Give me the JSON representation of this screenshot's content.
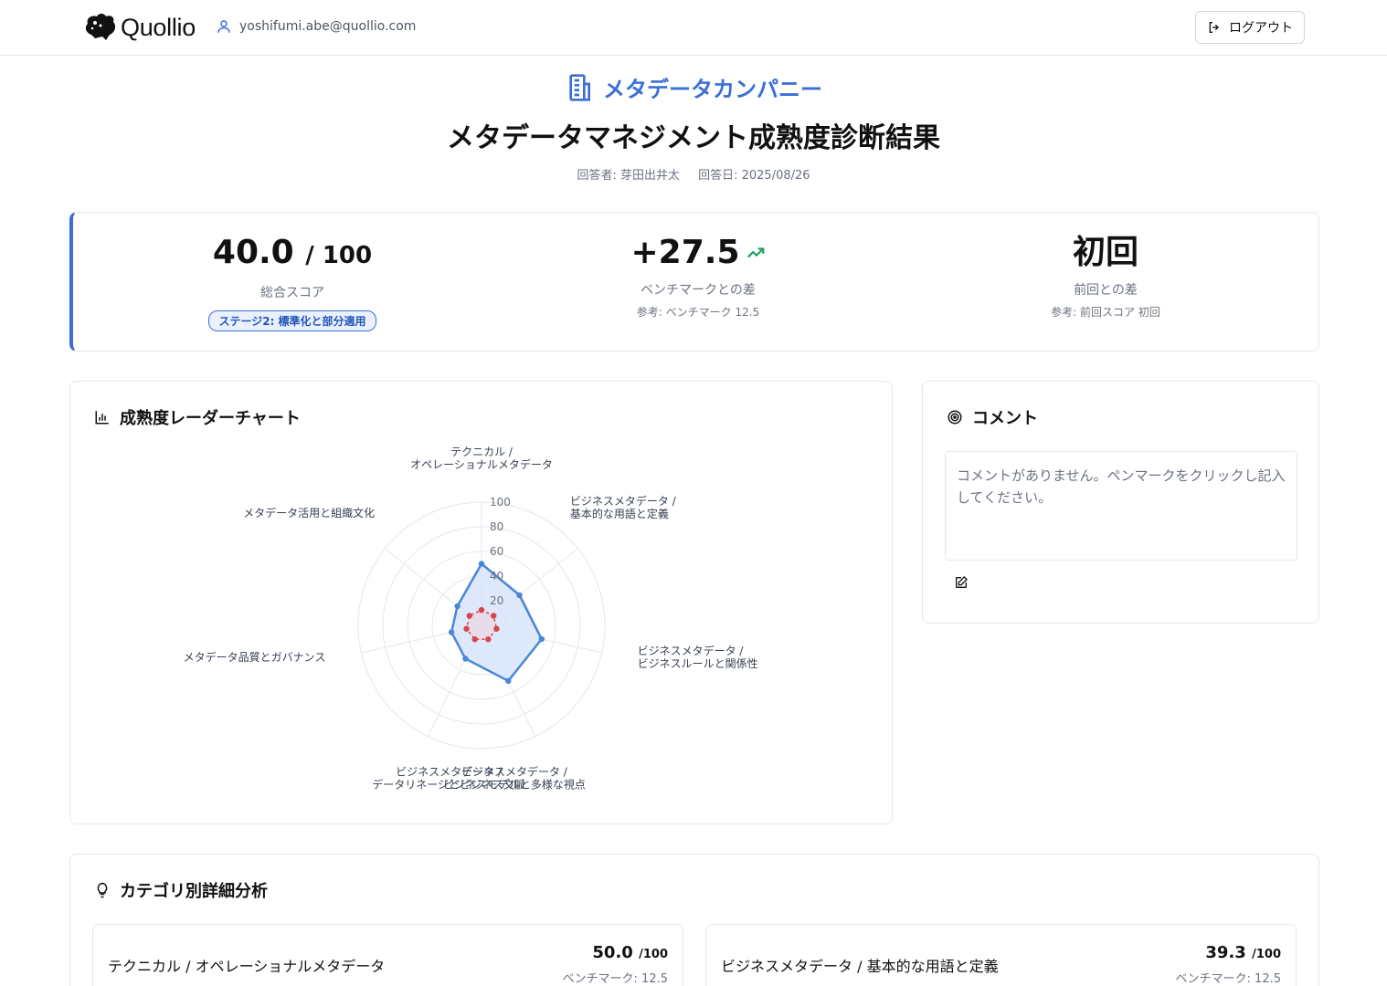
{
  "header": {
    "logo_text": "Quollio",
    "user_email": "yoshifumi.abe@quollio.com",
    "logout_label": "ログアウト"
  },
  "company_name": "メタデータカンパニー",
  "title": "メタデータマネジメント成熟度診断結果",
  "respondent": "回答者: 芽田出井太",
  "answered_date": "回答日: 2025/08/26",
  "score": {
    "total": "40.0",
    "max": "/ 100",
    "total_label": "総合スコア",
    "stage": "ステージ2: 標準化と部分適用",
    "bench_diff": "+27.5",
    "bench_label": "ベンチマークとの差",
    "bench_ref": "参考: ベンチマーク 12.5",
    "prev_diff": "初回",
    "prev_label": "前回との差",
    "prev_ref": "参考: 前回スコア 初回"
  },
  "radar": {
    "title": "成熟度レーダーチャート"
  },
  "chart_data": {
    "type": "radar",
    "axes": [
      [
        "テクニカル /",
        "オペレーショナルメタデータ"
      ],
      [
        "ビジネスメタデータ /",
        "基本的な用語と定義"
      ],
      [
        "ビジネスメタデータ /",
        "ビジネスルールと関係性"
      ],
      [
        "ビジネスメタデータ /",
        "ビジネスモデルと多様な視点"
      ],
      [
        "ビジネスメタデータ /",
        "データリネージとビジネス文脈"
      ],
      [
        "メタデータ品質とガバナンス"
      ],
      [
        "メタデータ活用と組織文化"
      ]
    ],
    "ticks": [
      20,
      40,
      60,
      80,
      100
    ],
    "range": [
      0,
      100
    ],
    "series": [
      {
        "values": [
          50.0,
          39.3,
          50.0,
          50.0,
          30.0,
          25.0,
          25.0
        ],
        "color": "#4a86d8",
        "fill": "#d6e4fb"
      },
      {
        "values": [
          12.5,
          12.5,
          12.5,
          12.5,
          12.5,
          12.5,
          12.5
        ],
        "color": "#d9434b"
      }
    ]
  },
  "comment": {
    "title": "コメント",
    "placeholder": "コメントがありません。ペンマークをクリックし記入してください。"
  },
  "categories": {
    "title": "カテゴリ別詳細分析",
    "items": [
      {
        "name": "テクニカル / オペレーショナルメタデータ",
        "score": "50.0",
        "max": "/100",
        "bench": "ベンチマーク: 12.5"
      },
      {
        "name": "ビジネスメタデータ / 基本的な用語と定義",
        "score": "39.3",
        "max": "/100",
        "bench": "ベンチマーク: 12.5"
      }
    ]
  }
}
